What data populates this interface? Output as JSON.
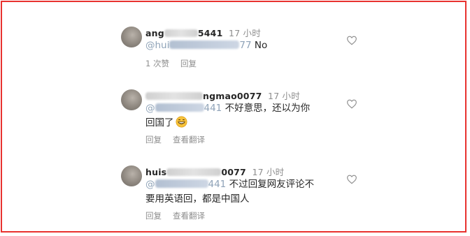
{
  "comments": [
    {
      "username_visible": "ang",
      "username_tail": "5441",
      "time": "17 小时",
      "mention_visible": "@hui",
      "mention_tail": "77",
      "text": "No",
      "actions": {
        "likes": "1 次赞",
        "reply": "回复"
      }
    },
    {
      "username_visible": "",
      "username_tail": "ngmao0077",
      "time": "17 小时",
      "mention_visible": "@",
      "mention_tail": "441",
      "text_line1": "不好意思，还以为你",
      "text_line2": "回国了",
      "actions": {
        "reply": "回复",
        "translate": "查看翻译"
      }
    },
    {
      "username_visible": "huis",
      "username_tail": "0077",
      "time": "17 小时",
      "mention_visible": "@",
      "mention_tail": "441",
      "text_line1": "不过回复网友评论不",
      "text_line2": "要用英语回，都是中国人",
      "actions": {
        "reply": "回复",
        "translate": "查看翻译"
      }
    }
  ],
  "icons": [
    "heart-icon",
    "grinning-emoji-icon"
  ],
  "colors": {
    "border": "#e8322f",
    "text": "#262626",
    "muted": "#8e8e8e"
  }
}
